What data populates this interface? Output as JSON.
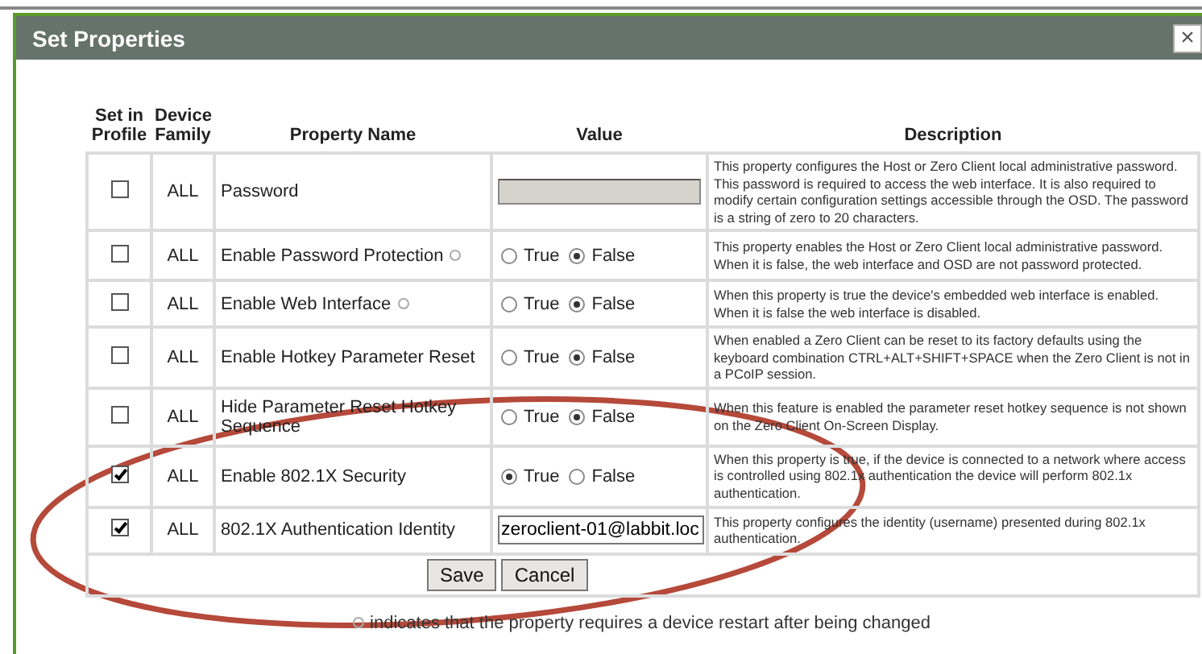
{
  "dialog": {
    "title": "Set Properties",
    "close": "×"
  },
  "columns": [
    "Set in Profile",
    "Device Family",
    "Property Name",
    "Value",
    "Description"
  ],
  "rows": [
    {
      "checked": false,
      "family": "ALL",
      "name": "Password",
      "restart": false,
      "kind": "password",
      "description": "This property configures the Host or Zero Client local administrative password. This password is required to access the web interface. It is also required to modify certain configuration settings accessible through the OSD. The password is a string of zero to 20 characters."
    },
    {
      "checked": false,
      "family": "ALL",
      "name": "Enable Password Protection",
      "restart": true,
      "kind": "radio",
      "options": [
        {
          "label": "True",
          "selected": false
        },
        {
          "label": "False",
          "selected": true
        }
      ],
      "description": "This property enables the Host or Zero Client local administrative password. When it is false, the web interface and OSD are not password protected."
    },
    {
      "checked": false,
      "family": "ALL",
      "name": "Enable Web Interface",
      "restart": true,
      "kind": "radio",
      "options": [
        {
          "label": "True",
          "selected": false
        },
        {
          "label": "False",
          "selected": true
        }
      ],
      "description": "When this property is true the device's embedded web interface is enabled. When it is false the web interface is disabled."
    },
    {
      "checked": false,
      "family": "ALL",
      "name": "Enable Hotkey Parameter Reset",
      "restart": false,
      "kind": "radio",
      "options": [
        {
          "label": "True",
          "selected": false
        },
        {
          "label": "False",
          "selected": true
        }
      ],
      "description": "When enabled a Zero Client can be reset to its factory defaults using the keyboard combination CTRL+ALT+SHIFT+SPACE when the Zero Client is not in a PCoIP session."
    },
    {
      "checked": false,
      "family": "ALL",
      "name": "Hide Parameter Reset Hotkey Sequence",
      "restart": false,
      "kind": "radio",
      "options": [
        {
          "label": "True",
          "selected": false
        },
        {
          "label": "False",
          "selected": true
        }
      ],
      "description": "When this feature is enabled the parameter reset hotkey sequence is not shown on the Zero Client On-Screen Display."
    },
    {
      "checked": true,
      "family": "ALL",
      "name": "Enable 802.1X Security",
      "restart": false,
      "kind": "radio",
      "options": [
        {
          "label": "True",
          "selected": true
        },
        {
          "label": "False",
          "selected": false
        }
      ],
      "description": "When this property is true, if the device is connected to a network where access is controlled using 802.1x authentication the device will perform 802.1x authentication."
    },
    {
      "checked": true,
      "family": "ALL",
      "name": "802.1X Authentication Identity",
      "restart": false,
      "kind": "text",
      "value": "zeroclient-01@labbit.loc",
      "description": "This property configures the identity (username) presented during 802.1x authentication."
    }
  ],
  "buttons": [
    "Save",
    "Cancel"
  ],
  "footnote": "indicates that the property requires a device restart after being changed"
}
